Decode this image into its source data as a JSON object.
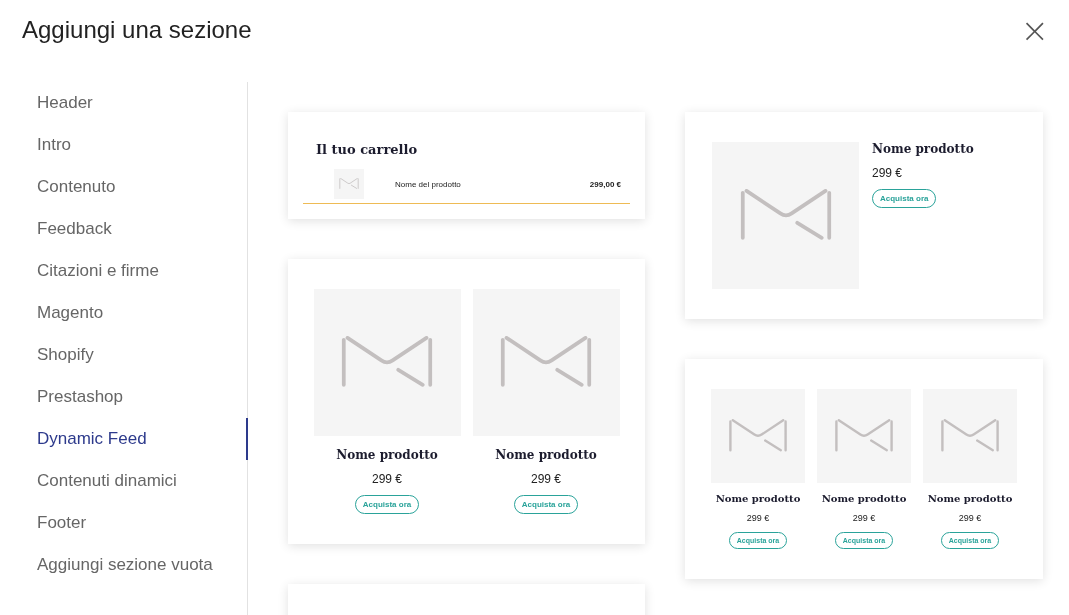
{
  "dialog": {
    "title": "Aggiungi una sezione",
    "close": "×"
  },
  "sidebar": {
    "items": [
      {
        "label": "Header",
        "selected": false
      },
      {
        "label": "Intro",
        "selected": false
      },
      {
        "label": "Contenuto",
        "selected": false
      },
      {
        "label": "Feedback",
        "selected": false
      },
      {
        "label": "Citazioni e firme",
        "selected": false
      },
      {
        "label": "Magento",
        "selected": false
      },
      {
        "label": "Shopify",
        "selected": false
      },
      {
        "label": "Prestashop",
        "selected": false
      },
      {
        "label": "Dynamic Feed",
        "selected": true
      },
      {
        "label": "Contenuti dinamici",
        "selected": false
      },
      {
        "label": "Footer",
        "selected": false
      },
      {
        "label": "Aggiungi sezione vuota",
        "selected": false
      }
    ]
  },
  "columns": [
    [
      {
        "kind": "cart",
        "title": "Il tuo carrello",
        "product": "Nome del prodotto",
        "price": "299,00 €"
      },
      {
        "kind": "grid",
        "products": [
          {
            "name": "Nome prodotto",
            "price": "299 €",
            "button": "Acquista ora"
          },
          {
            "name": "Nome prodotto",
            "price": "299 €",
            "button": "Acquista ora"
          }
        ]
      },
      {
        "kind": "blank"
      }
    ],
    [
      {
        "kind": "single",
        "products": [
          {
            "name": "Nome prodotto",
            "price": "299 €",
            "button": "Acquista ora"
          }
        ]
      },
      {
        "kind": "grid",
        "products": [
          {
            "name": "Nome prodotto",
            "price": "299 €",
            "button": "Acquista ora"
          },
          {
            "name": "Nome prodotto",
            "price": "299 €",
            "button": "Acquista ora"
          },
          {
            "name": "Nome prodotto",
            "price": "299 €",
            "button": "Acquista ora"
          }
        ]
      }
    ]
  ]
}
